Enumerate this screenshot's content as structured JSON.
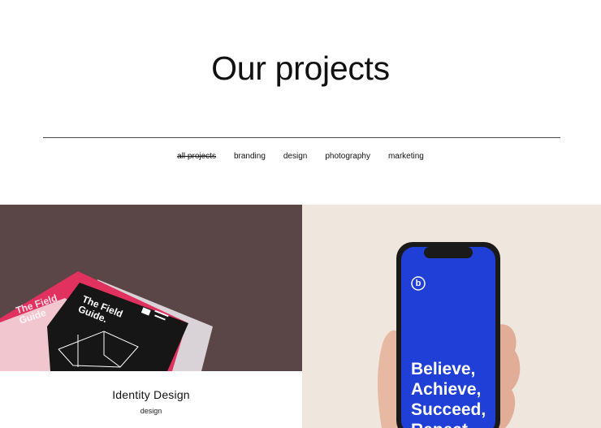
{
  "header": {
    "title": "Our projects"
  },
  "filters": [
    {
      "label": "all projects",
      "active": true
    },
    {
      "label": "branding",
      "active": false
    },
    {
      "label": "design",
      "active": false
    },
    {
      "label": "photography",
      "active": false
    },
    {
      "label": "marketing",
      "active": false
    }
  ],
  "projects": [
    {
      "title": "Identity Design",
      "category": "design",
      "image": {
        "book_front_title": "The Field Guide.",
        "book_back_title": "The Field Guide"
      }
    },
    {
      "image": {
        "phone_text_lines": [
          "Believe,",
          "Achieve,",
          "Succeed,",
          "Repeat"
        ],
        "phone_logo": "b"
      }
    }
  ],
  "colors": {
    "accent_blue": "#1f3fd6",
    "brown_bg": "#5a4646",
    "pink": "#e0315f",
    "peach_bg": "#efe6dd"
  }
}
